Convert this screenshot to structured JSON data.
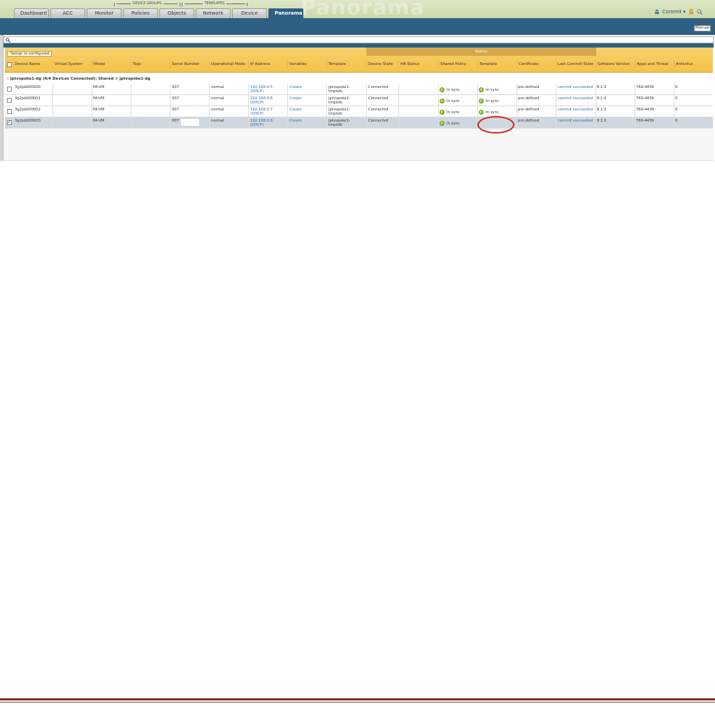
{
  "nav": {
    "group_device_groups": "DEVICE GROUPS",
    "group_templates": "TEMPLATES",
    "watermark": "Panorama",
    "tabs": [
      "Dashboard",
      "ACC",
      "Monitor",
      "Policies",
      "Objects",
      "Network",
      "Device",
      "Panorama"
    ],
    "active_tab": "Panorama",
    "commit_label": "Commit ▾"
  },
  "toolbar": {
    "mode_label": "Manual"
  },
  "table": {
    "status_band": "Status",
    "configured_badge": "'Setup' is configured",
    "columns": [
      "Device Name",
      "Virtual System",
      "Model",
      "Tags",
      "Serial Number",
      "Operational Mode",
      "IP Address",
      "Variables",
      "Template",
      "Device State",
      "HA Status",
      "Shared Policy",
      "Template",
      "Certificate",
      "Last Commit State",
      "Software Version",
      "Apps and Threat",
      "Antivirus"
    ],
    "group_label": "jptvspoke1-dg (4/4 Devices Connected): Shared > jptvspoke1-dg",
    "rows": [
      {
        "device_name": "3g2pb000000",
        "model": "PA-VM",
        "serial": "007",
        "mode": "normal",
        "ip": "192.168.0.5",
        "ip_sub": "(DHCP)",
        "variables": "Create",
        "template": "jptvspoke1-",
        "template_sub": "tmplstk",
        "state": "Connected",
        "shared_policy": "In sync",
        "template_status": "In sync",
        "certificate": "pre-defined",
        "commit_state": "commit succeeded",
        "software": "8.1.0",
        "apps": "769-4439",
        "antivirus": "0",
        "checked": false
      },
      {
        "device_name": "3g2pb000001",
        "model": "PA-VM",
        "serial": "007",
        "mode": "normal",
        "ip": "192.168.0.6",
        "ip_sub": "(DHCP)",
        "variables": "Create",
        "template": "jptvspoke1-",
        "template_sub": "tmplstk",
        "state": "Connected",
        "shared_policy": "In sync",
        "template_status": "In sync",
        "certificate": "pre-defined",
        "commit_state": "commit succeeded",
        "software": "8.1.0",
        "apps": "769-4439",
        "antivirus": "0",
        "checked": false
      },
      {
        "device_name": "3g2pb000002",
        "model": "PA-VM",
        "serial": "007",
        "mode": "normal",
        "ip": "192.168.0.7",
        "ip_sub": "(DHCP)",
        "variables": "Create",
        "template": "jptvspoke1-",
        "template_sub": "tmplstk",
        "state": "Connected",
        "shared_policy": "In sync",
        "template_status": "In sync",
        "certificate": "pre-defined",
        "commit_state": "commit succeeded",
        "software": "8.1.0",
        "apps": "769-4439",
        "antivirus": "0",
        "checked": false
      },
      {
        "device_name": "3g2pb000003",
        "model": "PA-VM",
        "serial": "007",
        "mode": "normal",
        "ip": "192.168.0.8",
        "ip_sub": "(DHCP)",
        "variables": "Create",
        "template": "jptvspoke1-",
        "template_sub": "tmplstk",
        "state": "Connected",
        "shared_policy": "In sync",
        "template_status": "",
        "certificate": "pre-defined",
        "commit_state": "commit succeeded",
        "software": "8.1.0",
        "apps": "769-4439",
        "antivirus": "0",
        "checked": true
      }
    ]
  },
  "colors": {
    "nav_blue": "#2f5f82",
    "header_gold": "#f3c24a",
    "status_band": "#d7a84a",
    "link_blue": "#2f6ea7",
    "sync_green": "#7fb42a",
    "annotation_red": "#d91f1f",
    "footer_rule": "#7b2c22"
  }
}
